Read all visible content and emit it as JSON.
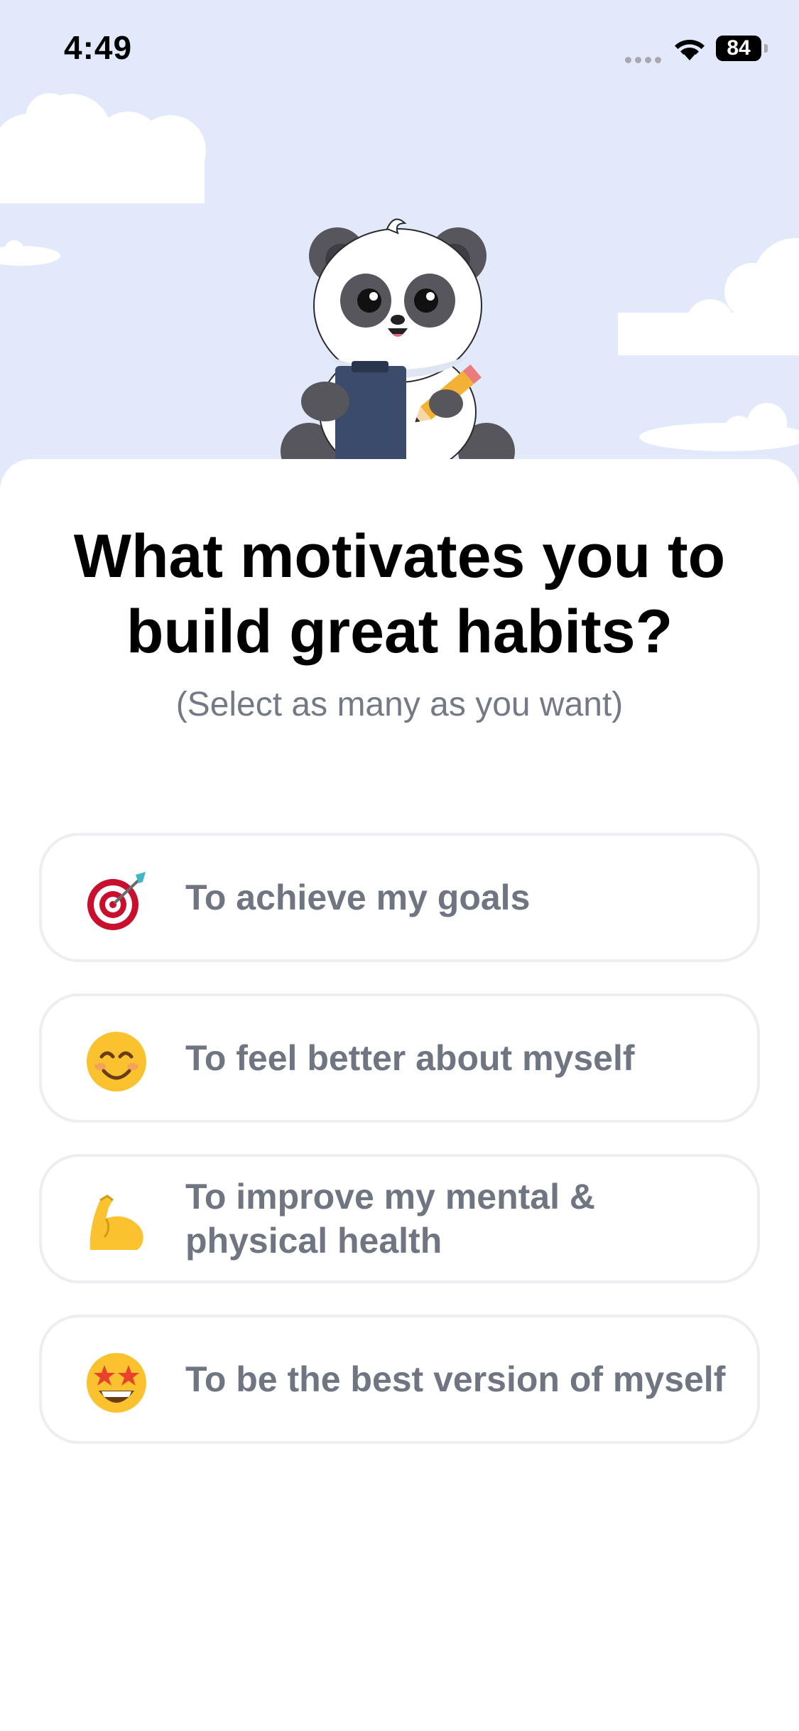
{
  "status": {
    "time": "4:49",
    "battery": "84"
  },
  "question": {
    "title": "What motivates you to build great habits?",
    "subtitle": "(Select as many as you want)"
  },
  "options": [
    {
      "icon": "target-icon",
      "label": "To achieve my goals"
    },
    {
      "icon": "smiling-face-icon",
      "label": "To feel better about myself"
    },
    {
      "icon": "flexed-biceps-icon",
      "label": "To improve my mental & physical health"
    },
    {
      "icon": "star-struck-face-icon",
      "label": "To be the best version of myself"
    }
  ],
  "colors": {
    "sky": "#e1e9fb",
    "option_border": "#eceef1",
    "option_text": "#6f7581",
    "subtitle": "#747a85"
  }
}
